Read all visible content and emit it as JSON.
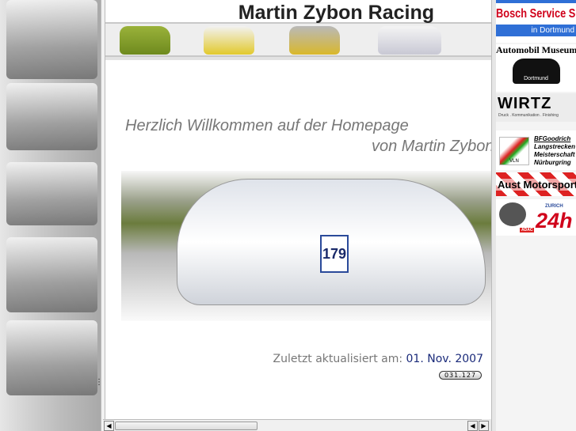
{
  "site_title": "Martin Zybon Racing",
  "welcome": {
    "line1": "Herzlich Willkommen auf der Homepage",
    "line2": "von Martin Zybon"
  },
  "hero": {
    "car_number": "179"
  },
  "updated": {
    "label": "Zuletzt aktualisiert am:",
    "date": "01. Nov. 2007"
  },
  "counter": "031.127",
  "sponsors": [
    {
      "name": "Bosch Service Schröder",
      "sub": "in Dortmund"
    },
    {
      "name": "Automobil Museum",
      "sub": "Dortmund"
    },
    {
      "name": "WIRTZ",
      "sub": "Druck . Kommunikation . Finishing"
    },
    {
      "name": "BFGoodrich",
      "sub": "Langstrecken Meisterschaft Nürburgring",
      "badge": "VLN"
    },
    {
      "name": "Aust Motorsport"
    },
    {
      "name": "24h",
      "sub": "ZURICH",
      "badge": "ADAC"
    }
  ],
  "scroll": {
    "left_icon": "arrow-left-icon",
    "right_icon": "arrow-right-icon"
  },
  "colors": {
    "date": "#1a2a7a",
    "bosch_red": "#d0021b",
    "bosch_blue": "#2f6fd6"
  }
}
